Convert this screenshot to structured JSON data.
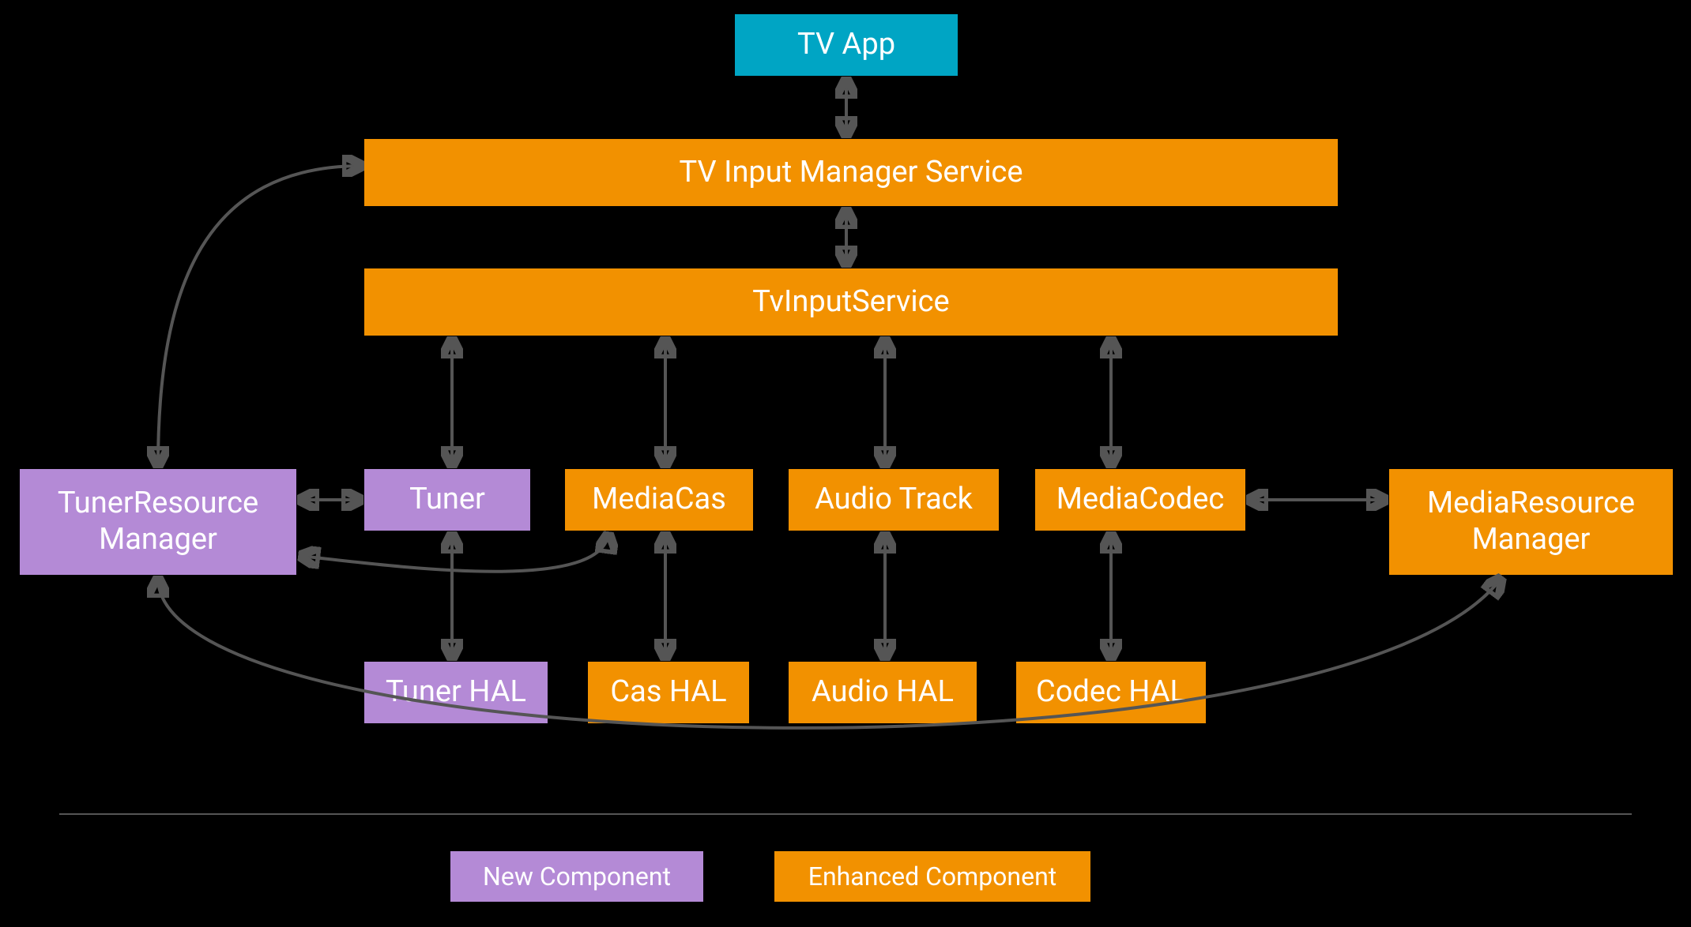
{
  "boxes": {
    "tv_app": "TV App",
    "tims": "TV Input Manager Service",
    "tis": "TvInputService",
    "trm_l1": "TunerResource",
    "trm_l2": "Manager",
    "mrm_l1": "MediaResource",
    "mrm_l2": "Manager",
    "tuner": "Tuner",
    "mediacas": "MediaCas",
    "audiotrack": "Audio Track",
    "mediacodec": "MediaCodec",
    "tuner_hal": "Tuner HAL",
    "cas_hal": "Cas HAL",
    "audio_hal": "Audio HAL",
    "codec_hal": "Codec HAL"
  },
  "legend": {
    "new": "New Component",
    "enhanced": "Enhanced Component"
  },
  "colors": {
    "cyan": "#00a5c4",
    "orange": "#f29100",
    "purple": "#b48ad6",
    "arrow": "#555555",
    "bg": "#000000"
  }
}
